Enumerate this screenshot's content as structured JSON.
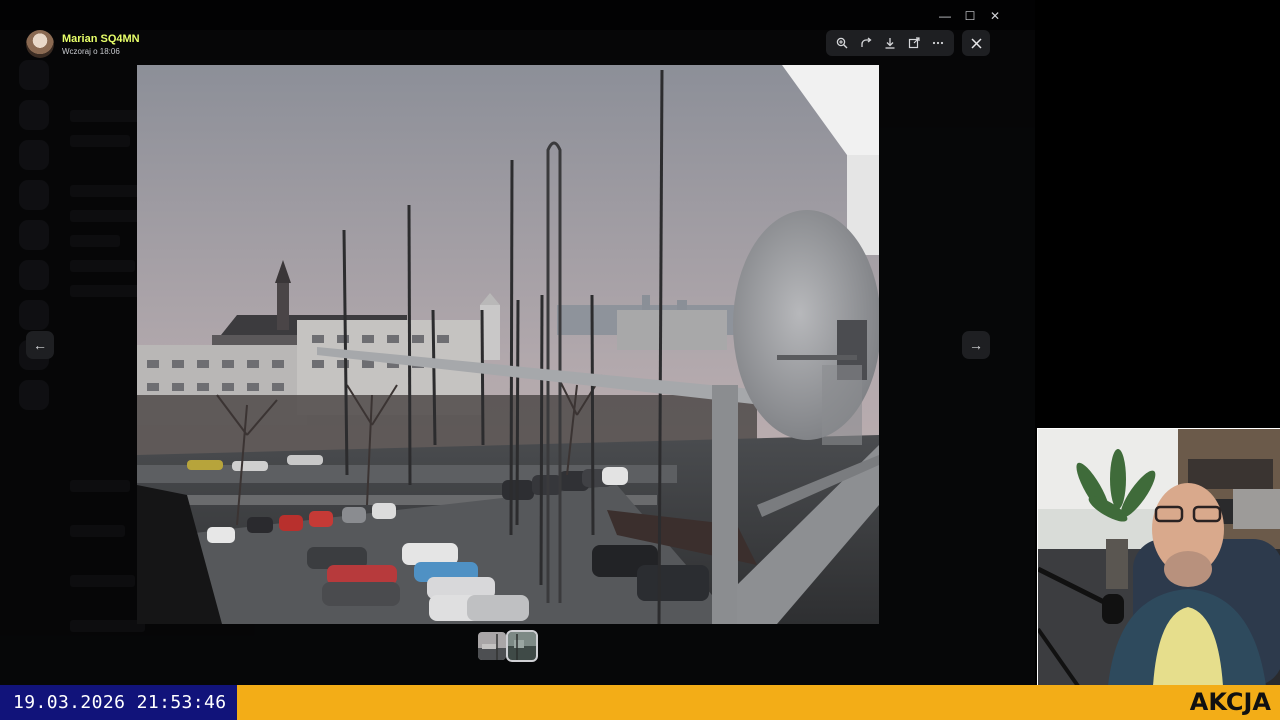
{
  "author": {
    "name": "Marian SQ4MN",
    "timestamp": "Wczoraj o 18:06"
  },
  "toolbar": {
    "zoom_icon": "zoom-in-icon",
    "rotate_icon": "rotate-icon",
    "download_icon": "download-icon",
    "open_icon": "open-external-icon",
    "more_icon": "more-icon",
    "close_icon": "close-icon"
  },
  "window": {
    "minimize": "—",
    "maximize": "☐",
    "close": "✕"
  },
  "navigation": {
    "prev_icon": "arrow-left-icon",
    "next_icon": "arrow-right-icon",
    "prev_glyph": "←",
    "next_glyph": "→"
  },
  "gallery": {
    "thumbnail_count": 2,
    "selected_index": 1
  },
  "overlay": {
    "datetime": "19.03.2026 21:53:46",
    "label": "AKCJA"
  },
  "colors": {
    "author_name": "#e8ff6a",
    "banner_blue": "#11137a",
    "banner_orange": "#f3ad17",
    "toolbar_bg": "#1e1f22"
  }
}
